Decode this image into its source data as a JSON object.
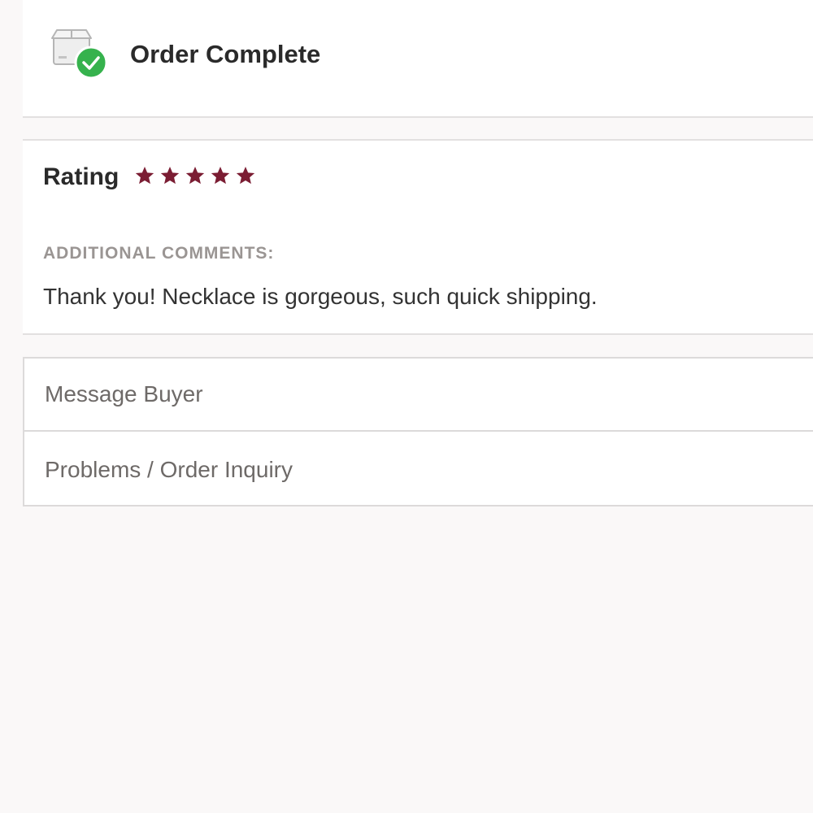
{
  "status": {
    "title": "Order Complete",
    "icon": "package-check-icon",
    "check_color": "#36b24d"
  },
  "review": {
    "rating_label": "Rating",
    "rating": 5,
    "rating_max": 5,
    "star_color": "#7b1d33",
    "comments_heading": "ADDITIONAL COMMENTS:",
    "comments_text": "Thank you! Necklace is gorgeous, such quick shipping."
  },
  "actions": {
    "items": [
      {
        "label": "Message Buyer"
      },
      {
        "label": "Problems / Order Inquiry"
      }
    ]
  }
}
